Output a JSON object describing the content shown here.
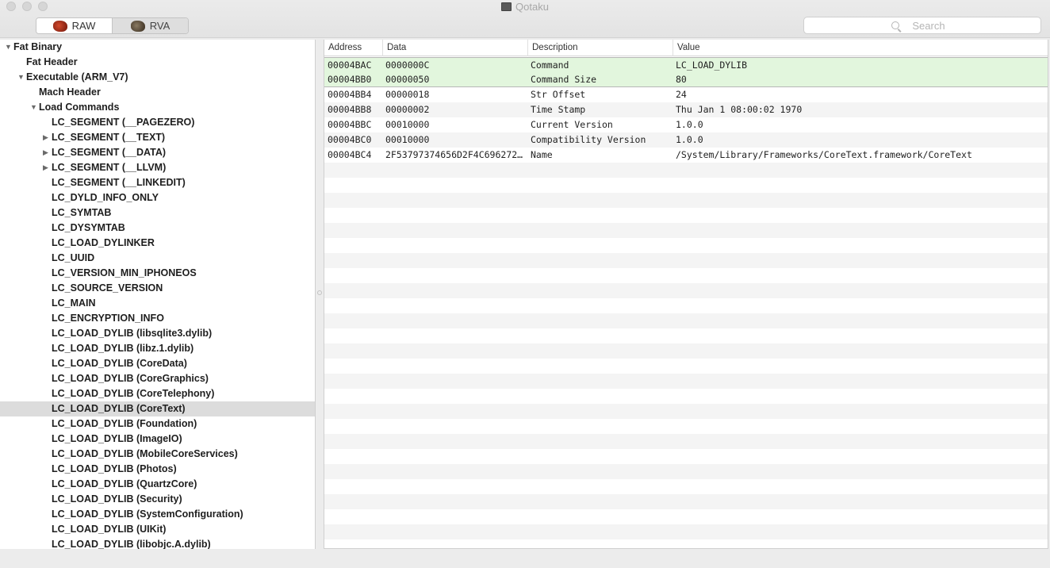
{
  "window": {
    "title": "Qotaku"
  },
  "toolbar": {
    "segments": [
      {
        "label": "RAW",
        "icon": "raw-icon",
        "active": true
      },
      {
        "label": "RVA",
        "icon": "rva-icon",
        "active": false
      }
    ],
    "search_placeholder": "Search"
  },
  "tree": [
    {
      "label": "Fat Binary",
      "disclosure": "expanded",
      "level": 0
    },
    {
      "label": "Fat Header",
      "disclosure": "none",
      "level": 1
    },
    {
      "label": "Executable",
      "paren": "(ARM_V7)",
      "disclosure": "expanded",
      "level": 1
    },
    {
      "label": "Mach Header",
      "disclosure": "none",
      "level": 2
    },
    {
      "label": "Load Commands",
      "disclosure": "expanded",
      "level": 2
    },
    {
      "label": "LC_SEGMENT",
      "paren": "(__PAGEZERO)",
      "disclosure": "none",
      "level": 3
    },
    {
      "label": "LC_SEGMENT",
      "paren": "(__TEXT)",
      "disclosure": "collapsed",
      "level": 3
    },
    {
      "label": "LC_SEGMENT",
      "paren": "(__DATA)",
      "disclosure": "collapsed",
      "level": 3
    },
    {
      "label": "LC_SEGMENT",
      "paren": "(__LLVM)",
      "disclosure": "collapsed",
      "level": 3
    },
    {
      "label": "LC_SEGMENT",
      "paren": "(__LINKEDIT)",
      "disclosure": "none",
      "level": 3
    },
    {
      "label": "LC_DYLD_INFO_ONLY",
      "disclosure": "none",
      "level": 3
    },
    {
      "label": "LC_SYMTAB",
      "disclosure": "none",
      "level": 3
    },
    {
      "label": "LC_DYSYMTAB",
      "disclosure": "none",
      "level": 3
    },
    {
      "label": "LC_LOAD_DYLINKER",
      "disclosure": "none",
      "level": 3
    },
    {
      "label": "LC_UUID",
      "disclosure": "none",
      "level": 3
    },
    {
      "label": "LC_VERSION_MIN_IPHONEOS",
      "disclosure": "none",
      "level": 3
    },
    {
      "label": "LC_SOURCE_VERSION",
      "disclosure": "none",
      "level": 3
    },
    {
      "label": "LC_MAIN",
      "disclosure": "none",
      "level": 3
    },
    {
      "label": "LC_ENCRYPTION_INFO",
      "disclosure": "none",
      "level": 3
    },
    {
      "label": "LC_LOAD_DYLIB",
      "paren": "(libsqlite3.dylib)",
      "disclosure": "none",
      "level": 3
    },
    {
      "label": "LC_LOAD_DYLIB",
      "paren": "(libz.1.dylib)",
      "disclosure": "none",
      "level": 3
    },
    {
      "label": "LC_LOAD_DYLIB",
      "paren": "(CoreData)",
      "disclosure": "none",
      "level": 3
    },
    {
      "label": "LC_LOAD_DYLIB",
      "paren": "(CoreGraphics)",
      "disclosure": "none",
      "level": 3
    },
    {
      "label": "LC_LOAD_DYLIB",
      "paren": "(CoreTelephony)",
      "disclosure": "none",
      "level": 3
    },
    {
      "label": "LC_LOAD_DYLIB",
      "paren": "(CoreText)",
      "disclosure": "none",
      "level": 3,
      "selected": true
    },
    {
      "label": "LC_LOAD_DYLIB",
      "paren": "(Foundation)",
      "disclosure": "none",
      "level": 3
    },
    {
      "label": "LC_LOAD_DYLIB",
      "paren": "(ImageIO)",
      "disclosure": "none",
      "level": 3
    },
    {
      "label": "LC_LOAD_DYLIB",
      "paren": "(MobileCoreServices)",
      "disclosure": "none",
      "level": 3
    },
    {
      "label": "LC_LOAD_DYLIB",
      "paren": "(Photos)",
      "disclosure": "none",
      "level": 3
    },
    {
      "label": "LC_LOAD_DYLIB",
      "paren": "(QuartzCore)",
      "disclosure": "none",
      "level": 3
    },
    {
      "label": "LC_LOAD_DYLIB",
      "paren": "(Security)",
      "disclosure": "none",
      "level": 3
    },
    {
      "label": "LC_LOAD_DYLIB",
      "paren": "(SystemConfiguration)",
      "disclosure": "none",
      "level": 3
    },
    {
      "label": "LC_LOAD_DYLIB",
      "paren": "(UIKit)",
      "disclosure": "none",
      "level": 3
    },
    {
      "label": "LC_LOAD_DYLIB",
      "paren": "(libobjc.A.dylib)",
      "disclosure": "none",
      "level": 3
    }
  ],
  "table": {
    "columns": [
      "Address",
      "Data",
      "Description",
      "Value"
    ],
    "rows": [
      {
        "address": "00004BAC",
        "data": "0000000C",
        "description": "Command",
        "value": "LC_LOAD_DYLIB",
        "highlight": true
      },
      {
        "address": "00004BB0",
        "data": "00000050",
        "description": "Command Size",
        "value": "80",
        "highlight": true
      },
      {
        "address": "00004BB4",
        "data": "00000018",
        "description": "Str Offset",
        "value": "24"
      },
      {
        "address": "00004BB8",
        "data": "00000002",
        "description": "Time Stamp",
        "value": "Thu Jan  1 08:00:02 1970"
      },
      {
        "address": "00004BBC",
        "data": "00010000",
        "description": "Current Version",
        "value": "1.0.0"
      },
      {
        "address": "00004BC0",
        "data": "00010000",
        "description": "Compatibility Version",
        "value": "1.0.0"
      },
      {
        "address": "00004BC4",
        "data": "2F53797374656D2F4C69627261727",
        "description": "Name",
        "value": "/System/Library/Frameworks/CoreText.framework/CoreText"
      }
    ]
  },
  "colors": {
    "highlight_row": "#e2f6dd",
    "selected_tree_row": "#dcdcdc",
    "stripe": "#f4f4f4"
  }
}
